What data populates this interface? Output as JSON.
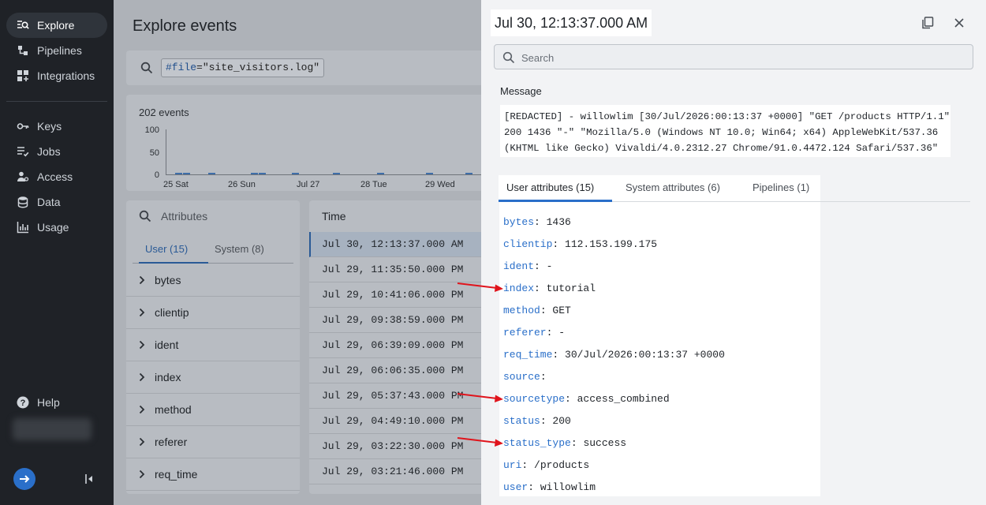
{
  "sidebar": {
    "items": [
      {
        "label": "Explore",
        "icon": "explore-icon",
        "active": true
      },
      {
        "label": "Pipelines",
        "icon": "pipelines-icon"
      },
      {
        "label": "Integrations",
        "icon": "integrations-icon"
      },
      {
        "label": "Keys",
        "icon": "key-icon"
      },
      {
        "label": "Jobs",
        "icon": "jobs-icon"
      },
      {
        "label": "Access",
        "icon": "access-icon"
      },
      {
        "label": "Data",
        "icon": "database-icon"
      },
      {
        "label": "Usage",
        "icon": "usage-icon"
      }
    ],
    "help_label": "Help"
  },
  "main": {
    "title": "Explore events",
    "query": {
      "key": "#file",
      "eq": "=",
      "value": "\"site_visitors.log\""
    },
    "histogram": {
      "count_label": "202 events",
      "yticks": [
        "100",
        "50",
        "0"
      ],
      "xticks": [
        "25 Sat",
        "26 Sun",
        "Jul 27",
        "28 Tue",
        "29 Wed"
      ]
    },
    "attributes": {
      "search_placeholder": "Attributes",
      "tabs": [
        "User (15)",
        "System (8)"
      ],
      "items": [
        "bytes",
        "clientip",
        "ident",
        "index",
        "method",
        "referer",
        "req_time"
      ]
    },
    "events": {
      "header": "Time",
      "rows": [
        "Jul 30, 12:13:37.000 AM",
        "Jul 29, 11:35:50.000 PM",
        "Jul 29, 10:41:06.000 PM",
        "Jul 29, 09:38:59.000 PM",
        "Jul 29, 06:39:09.000 PM",
        "Jul 29, 06:06:35.000 PM",
        "Jul 29, 05:37:43.000 PM",
        "Jul 29, 04:49:10.000 PM",
        "Jul 29, 03:22:30.000 PM",
        "Jul 29, 03:21:46.000 PM"
      ]
    }
  },
  "panel": {
    "title": "Jul 30, 12:13:37.000 AM",
    "search_placeholder": "Search",
    "message_label": "Message",
    "message_lines": [
      "[REDACTED] - willowlim [30/Jul/2026:00:13:37 +0000] \"GET /products HTTP/1.1\"",
      "200 1436 \"-\" \"Mozilla/5.0 (Windows NT 10.0; Win64; x64) AppleWebKit/537.36",
      "(KHTML like Gecko) Vivaldi/4.0.2312.27 Chrome/91.0.4472.124 Safari/537.36\""
    ],
    "tabs": [
      "User attributes (15)",
      "System attributes (6)",
      "Pipelines (1)"
    ],
    "user_attributes": [
      {
        "key": "bytes",
        "value": "1436"
      },
      {
        "key": "clientip",
        "value": "112.153.199.175"
      },
      {
        "key": "ident",
        "value": "-"
      },
      {
        "key": "index",
        "value": "tutorial"
      },
      {
        "key": "method",
        "value": "GET"
      },
      {
        "key": "referer",
        "value": "-"
      },
      {
        "key": "req_time",
        "value": "30/Jul/2026:00:13:37 +0000"
      },
      {
        "key": "source",
        "value": ""
      },
      {
        "key": "sourcetype",
        "value": "access_combined"
      },
      {
        "key": "status",
        "value": "200"
      },
      {
        "key": "status_type",
        "value": "success"
      },
      {
        "key": "uri",
        "value": "/products"
      },
      {
        "key": "user",
        "value": "willowlim"
      }
    ]
  },
  "colors": {
    "accent": "#2a6fc9",
    "annotation_arrow": "#e0141c"
  }
}
